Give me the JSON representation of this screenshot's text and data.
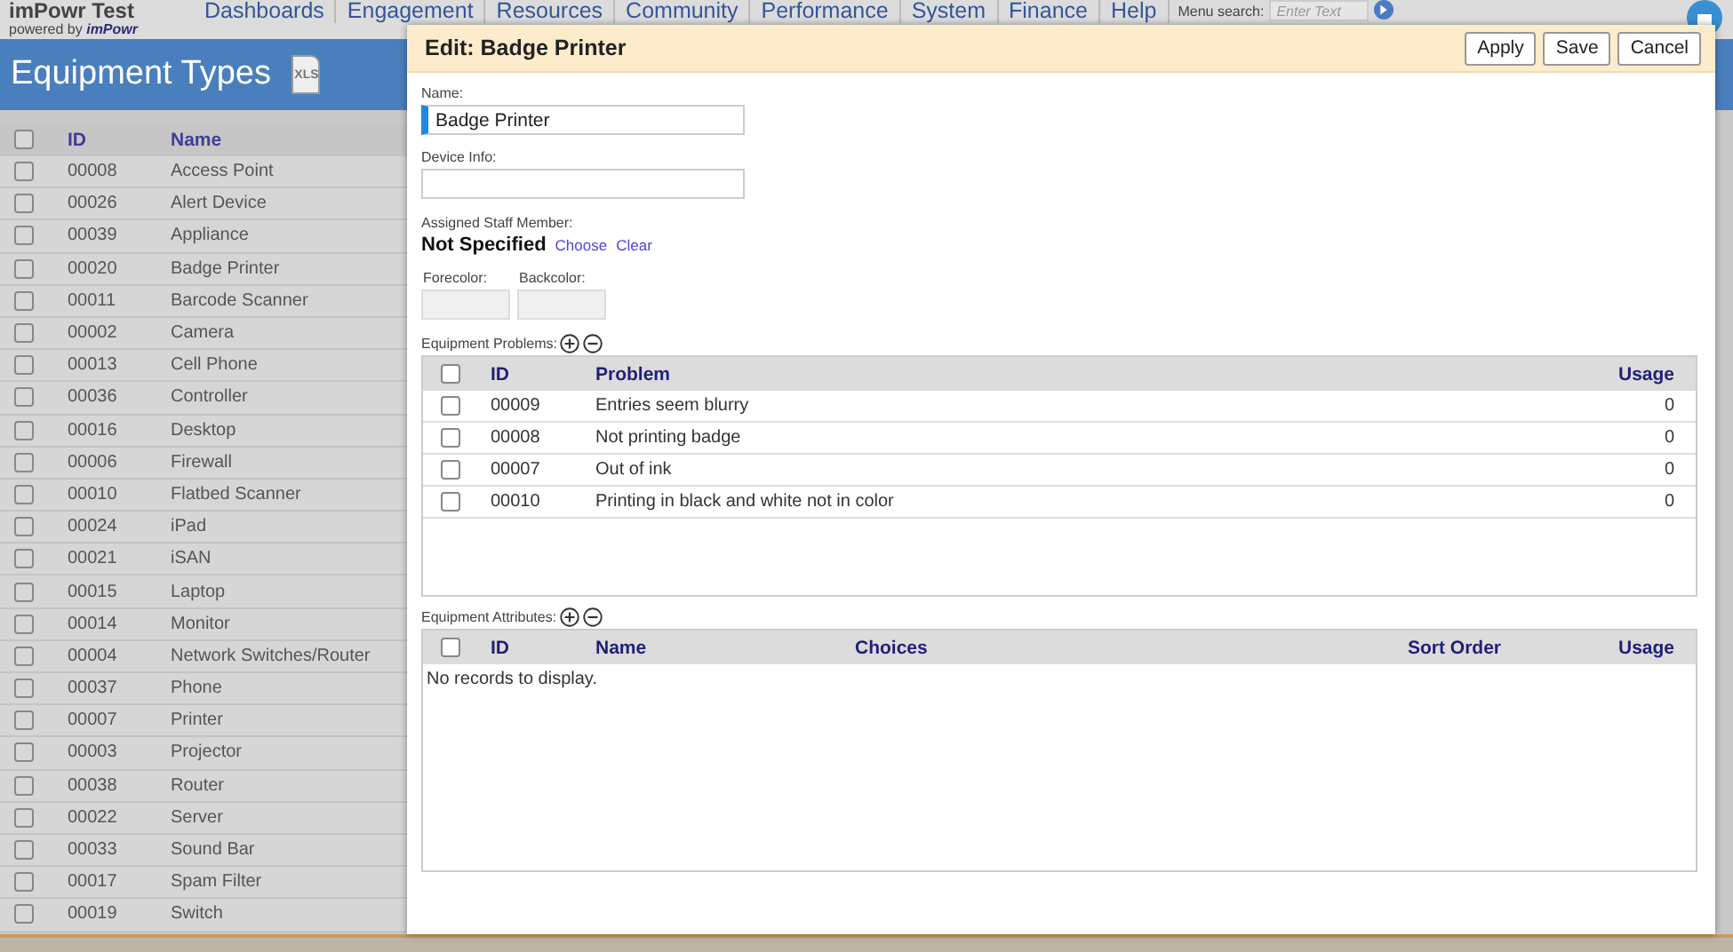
{
  "top_bar": {
    "logo_title": "imPowr Test",
    "logo_tagline": "powered by **imPowr**",
    "menu": [
      "Dashboards",
      "Engagement",
      "Resources",
      "Community",
      "Performance",
      "System",
      "Finance",
      "Help"
    ],
    "menu_search_label": "Menu search:",
    "menu_search": {
      "placeholder": "Enter Text"
    }
  },
  "page": {
    "title": "Equipment Types",
    "export_icon_label": "XLS"
  },
  "types_table": {
    "columns": [
      "ID",
      "Name"
    ],
    "header_checked": false,
    "rows": [
      {
        "id": "00008",
        "name": "Access Point",
        "checked": false
      },
      {
        "id": "00026",
        "name": "Alert Device",
        "checked": false
      },
      {
        "id": "00039",
        "name": "Appliance",
        "checked": false
      },
      {
        "id": "00020",
        "name": "Badge Printer",
        "checked": false
      },
      {
        "id": "00011",
        "name": "Barcode Scanner",
        "checked": false
      },
      {
        "id": "00002",
        "name": "Camera",
        "checked": false
      },
      {
        "id": "00013",
        "name": "Cell Phone",
        "checked": false
      },
      {
        "id": "00036",
        "name": "Controller",
        "checked": false
      },
      {
        "id": "00016",
        "name": "Desktop",
        "checked": false
      },
      {
        "id": "00006",
        "name": "Firewall",
        "checked": false
      },
      {
        "id": "00010",
        "name": "Flatbed Scanner",
        "checked": false
      },
      {
        "id": "00024",
        "name": "iPad",
        "checked": false
      },
      {
        "id": "00021",
        "name": "iSAN",
        "checked": false
      },
      {
        "id": "00015",
        "name": "Laptop",
        "checked": false
      },
      {
        "id": "00014",
        "name": "Monitor",
        "checked": false
      },
      {
        "id": "00004",
        "name": "Network Switches/Router",
        "checked": false
      },
      {
        "id": "00037",
        "name": "Phone",
        "checked": false
      },
      {
        "id": "00007",
        "name": "Printer",
        "checked": false
      },
      {
        "id": "00003",
        "name": "Projector",
        "checked": false
      },
      {
        "id": "00038",
        "name": "Router",
        "checked": false
      },
      {
        "id": "00022",
        "name": "Server",
        "checked": false
      },
      {
        "id": "00033",
        "name": "Sound Bar",
        "checked": false
      },
      {
        "id": "00017",
        "name": "Spam Filter",
        "checked": false
      },
      {
        "id": "00019",
        "name": "Switch",
        "checked": false
      }
    ]
  },
  "dialog": {
    "title": "Edit: Badge Printer",
    "buttons": [
      "Apply",
      "Save",
      "Cancel"
    ],
    "name_label": "Name:",
    "name_value": "Badge Printer",
    "device_info_label": "Device Info:",
    "staff_label": "Assigned Staff Member:",
    "staff_value": "Not Specified",
    "staff_links": [
      "Choose",
      "Clear"
    ],
    "forecolor_label": "Forecolor:",
    "backcolor_label": "Backcolor:",
    "problems": {
      "label": "Equipment Problems:",
      "columns": [
        "ID",
        "Problem",
        "Usage"
      ],
      "header_checked": false,
      "rows": [
        {
          "cells": [
            "00009",
            "Entries seem blurry",
            "0"
          ],
          "checked": false
        },
        {
          "cells": [
            "00008",
            "Not printing badge",
            "0"
          ],
          "checked": false
        },
        {
          "cells": [
            "00007",
            "Out of ink",
            "0"
          ],
          "checked": false
        },
        {
          "cells": [
            "00010",
            "Printing in black and white not in color",
            "0"
          ],
          "checked": false
        }
      ]
    },
    "attributes": {
      "label": "Equipment Attributes:",
      "columns": [
        "ID",
        "Name",
        "Choices",
        "Sort Order",
        "Usage"
      ],
      "header_checked": false,
      "empty_text": "No records to display."
    }
  }
}
